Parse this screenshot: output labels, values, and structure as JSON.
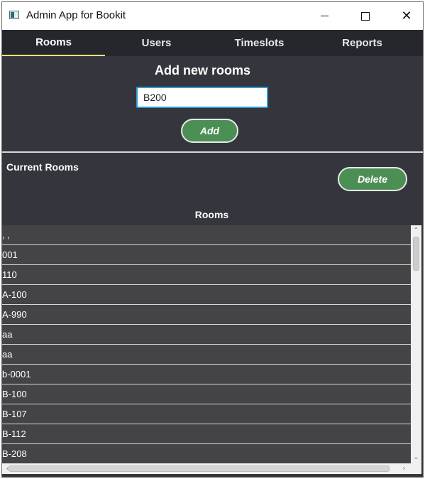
{
  "window": {
    "title": "Admin App for Bookit",
    "minimize_icon": "minimize-icon",
    "maximize_icon": "maximize-icon",
    "close_icon": "close-icon",
    "close_glyph": "✕"
  },
  "tabs": [
    {
      "label": "Rooms",
      "active": true
    },
    {
      "label": "Users",
      "active": false
    },
    {
      "label": "Timeslots",
      "active": false
    },
    {
      "label": "Reports",
      "active": false
    }
  ],
  "add_section": {
    "heading": "Add new rooms",
    "input_value": "B200",
    "add_label": "Add"
  },
  "current_section": {
    "label": "Current Rooms",
    "delete_label": "Delete"
  },
  "table": {
    "header": "Rooms",
    "rows": [
      ", ,",
      "001",
      "110",
      "A-100",
      "A-990",
      "aa",
      "aa",
      "b-0001",
      "B-100",
      "B-107",
      "B-112",
      "B-208"
    ]
  },
  "scrollbars": {
    "up_glyph": "⌃",
    "down_glyph": "⌄",
    "left_glyph": "‹",
    "right_glyph": "›"
  },
  "colors": {
    "tab_accent": "#f3e27a",
    "button_green": "#4c8f55",
    "input_focus": "#2e9bd6",
    "background": "#35363d"
  }
}
